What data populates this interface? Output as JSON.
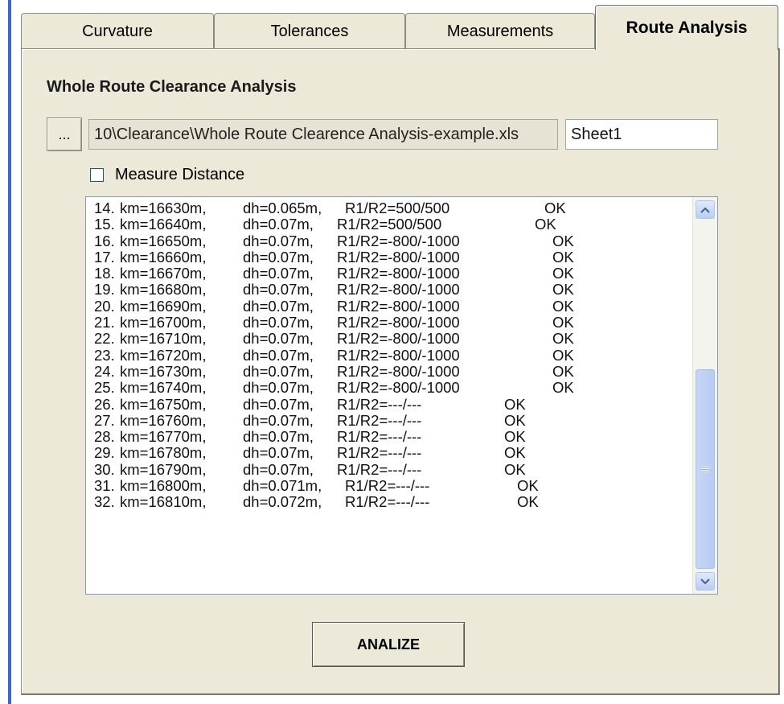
{
  "tabs": [
    {
      "label": "Curvature"
    },
    {
      "label": "Tolerances"
    },
    {
      "label": "Measurements"
    },
    {
      "label": "Route Analysis"
    }
  ],
  "active_tab": "Route Analysis",
  "section": {
    "title": "Whole Route Clearance Analysis"
  },
  "file": {
    "browse_label": "...",
    "path": "10\\Clearance\\Whole Route Clearence Analysis-example.xls",
    "sheet": "Sheet1"
  },
  "options": {
    "measure_distance_label": "Measure Distance",
    "measure_distance_checked": false
  },
  "results": [
    {
      "idx": "14.",
      "km": "km=16630m,",
      "dh": "dh=0.065m,",
      "r": "R1/R2=500/500",
      "status": "OK"
    },
    {
      "idx": "15.",
      "km": "km=16640m,",
      "dh": "dh=0.07m,",
      "r": "R1/R2=500/500",
      "status": "OK"
    },
    {
      "idx": "16.",
      "km": "km=16650m,",
      "dh": "dh=0.07m,",
      "r": "R1/R2=-800/-1000",
      "status": "OK"
    },
    {
      "idx": "17.",
      "km": "km=16660m,",
      "dh": "dh=0.07m,",
      "r": "R1/R2=-800/-1000",
      "status": "OK"
    },
    {
      "idx": "18.",
      "km": "km=16670m,",
      "dh": "dh=0.07m,",
      "r": "R1/R2=-800/-1000",
      "status": "OK"
    },
    {
      "idx": "19.",
      "km": "km=16680m,",
      "dh": "dh=0.07m,",
      "r": "R1/R2=-800/-1000",
      "status": "OK"
    },
    {
      "idx": "20.",
      "km": "km=16690m,",
      "dh": "dh=0.07m,",
      "r": "R1/R2=-800/-1000",
      "status": "OK"
    },
    {
      "idx": "21.",
      "km": "km=16700m,",
      "dh": "dh=0.07m,",
      "r": "R1/R2=-800/-1000",
      "status": "OK"
    },
    {
      "idx": "22.",
      "km": "km=16710m,",
      "dh": "dh=0.07m,",
      "r": "R1/R2=-800/-1000",
      "status": "OK"
    },
    {
      "idx": "23.",
      "km": "km=16720m,",
      "dh": "dh=0.07m,",
      "r": "R1/R2=-800/-1000",
      "status": "OK"
    },
    {
      "idx": "24.",
      "km": "km=16730m,",
      "dh": "dh=0.07m,",
      "r": "R1/R2=-800/-1000",
      "status": "OK"
    },
    {
      "idx": "25.",
      "km": "km=16740m,",
      "dh": "dh=0.07m,",
      "r": "R1/R2=-800/-1000",
      "status": "OK"
    },
    {
      "idx": "26.",
      "km": "km=16750m,",
      "dh": "dh=0.07m,",
      "r": "R1/R2=---/---",
      "status": "OK"
    },
    {
      "idx": "27.",
      "km": "km=16760m,",
      "dh": "dh=0.07m,",
      "r": "R1/R2=---/---",
      "status": "OK"
    },
    {
      "idx": "28.",
      "km": "km=16770m,",
      "dh": "dh=0.07m,",
      "r": "R1/R2=---/---",
      "status": "OK"
    },
    {
      "idx": "29.",
      "km": "km=16780m,",
      "dh": "dh=0.07m,",
      "r": "R1/R2=---/---",
      "status": "OK"
    },
    {
      "idx": "30.",
      "km": "km=16790m,",
      "dh": "dh=0.07m,",
      "r": "R1/R2=---/---",
      "status": "OK"
    },
    {
      "idx": "31.",
      "km": "km=16800m,",
      "dh": "dh=0.071m,",
      "r": "R1/R2=---/---",
      "status": "OK"
    },
    {
      "idx": "32.",
      "km": "km=16810m,",
      "dh": "dh=0.072m,",
      "r": "R1/R2=---/---",
      "status": "OK"
    }
  ],
  "scrollbar": {
    "up_icon": "chevron-up-icon",
    "down_icon": "chevron-down-icon"
  },
  "analize_label": "ANALIZE",
  "colors": {
    "accent": "#3f67c4",
    "panel": "#ece9d8"
  }
}
